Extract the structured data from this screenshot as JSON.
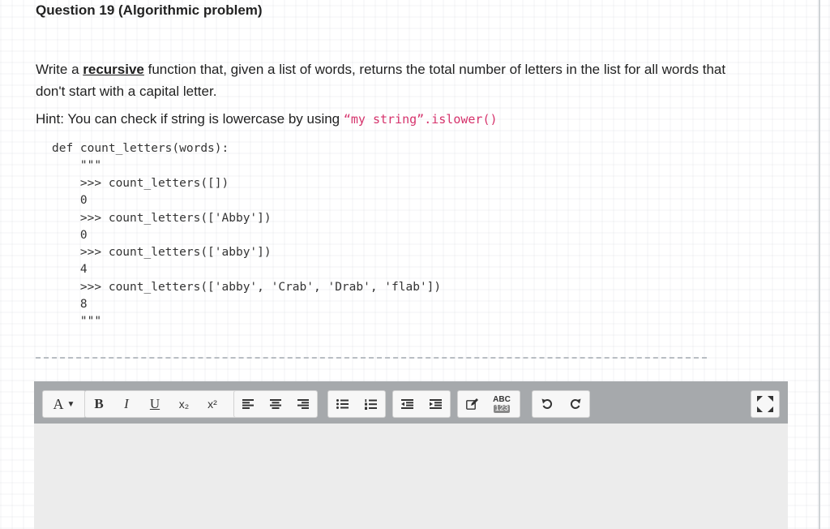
{
  "question": {
    "title": "Question 19 (Algorithmic problem)",
    "prompt_before": "Write a ",
    "prompt_emphasis": "recursive",
    "prompt_after": " function that, given a list of words, returns the total number of letters in the list for all words that don't start with a capital letter.",
    "hint_label": "Hint: You can check if string is lowercase by using ",
    "hint_code": "“my string”.islower()"
  },
  "code_lines": [
    "def count_letters(words):",
    "    \"\"\"",
    "    >>> count_letters([])",
    "    0",
    "    >>> count_letters(['Abby'])",
    "    0",
    "    >>> count_letters(['abby'])",
    "    4",
    "    >>> count_letters(['abby', 'Crab', 'Drab', 'flab'])",
    "    8",
    "    \"\"\""
  ],
  "toolbar": {
    "font_label": "A",
    "bold_label": "B",
    "italic_label": "I",
    "underline_label": "U",
    "subscript_label": "x₂",
    "superscript_label": "x²",
    "spellcheck_top": "ABC",
    "spellcheck_bottom": "123"
  },
  "editor": {
    "content": ""
  },
  "colors": {
    "toolbar_bg": "#a6a9ac",
    "editor_bg": "#ececec",
    "hint_code": "#d6336c"
  }
}
